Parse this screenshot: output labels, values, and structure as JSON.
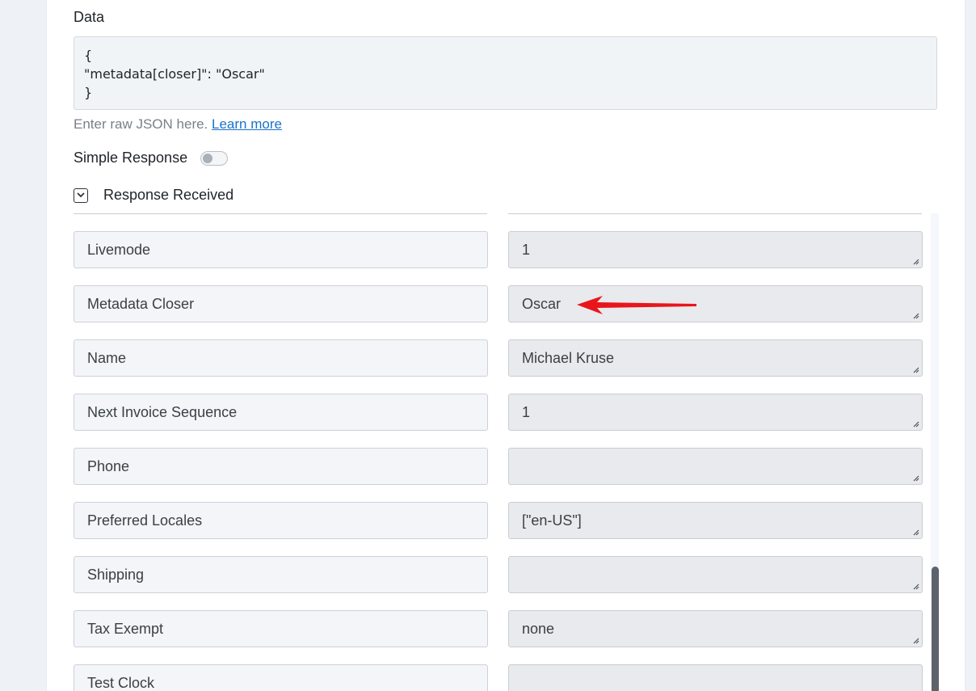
{
  "form": {
    "data_label": "Data",
    "json_lines": [
      "{",
      "\"metadata[closer]\": \"Oscar\"",
      "}"
    ],
    "help_text": "Enter raw JSON here.",
    "help_link": "Learn more",
    "simple_response_label": "Simple Response",
    "simple_response_enabled": false,
    "response_received_label": "Response Received"
  },
  "response_fields": [
    {
      "key": "Livemode",
      "value": "1"
    },
    {
      "key": "Metadata Closer",
      "value": "Oscar"
    },
    {
      "key": "Name",
      "value": "Michael Kruse"
    },
    {
      "key": "Next Invoice Sequence",
      "value": "1"
    },
    {
      "key": "Phone",
      "value": ""
    },
    {
      "key": "Preferred Locales",
      "value": "[\"en-US\"]"
    },
    {
      "key": "Shipping",
      "value": ""
    },
    {
      "key": "Tax Exempt",
      "value": "none"
    },
    {
      "key": "Test Clock",
      "value": ""
    }
  ],
  "colors": {
    "link": "#1a73c8",
    "annotation_arrow": "#e8161b"
  }
}
